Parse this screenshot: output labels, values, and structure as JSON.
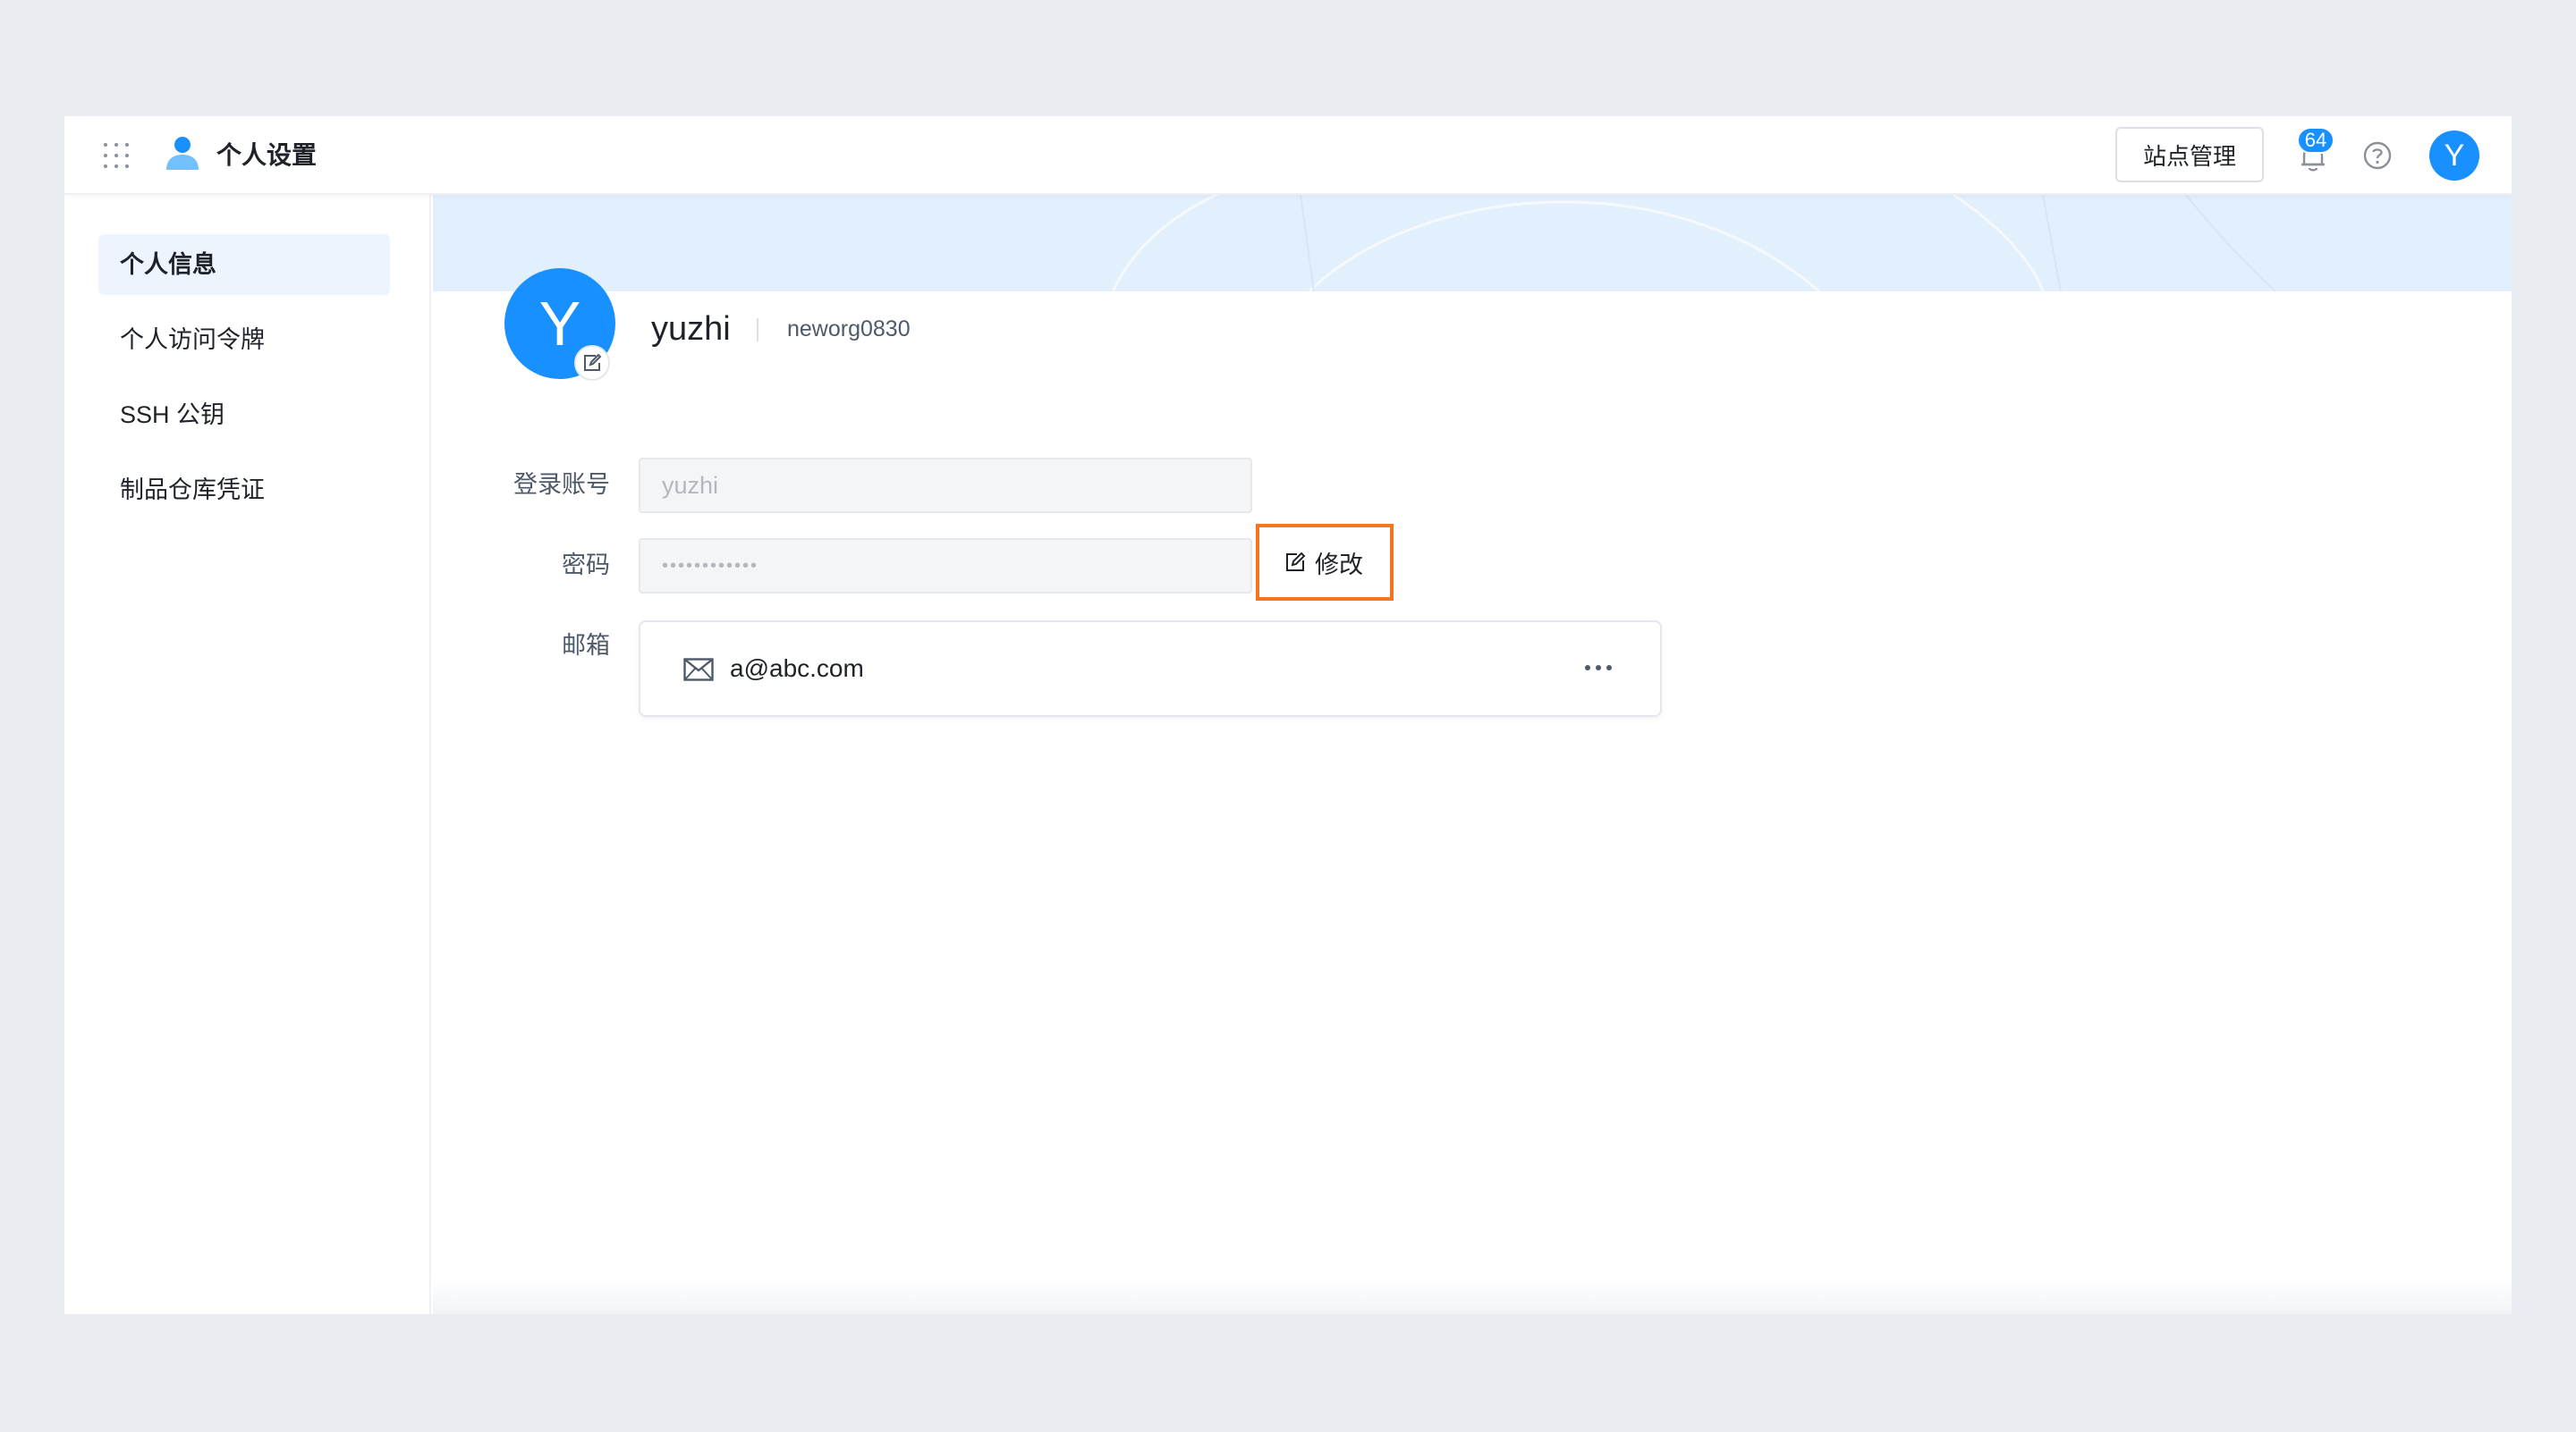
{
  "header": {
    "app_title": "个人设置",
    "site_manage_label": "站点管理",
    "notification_count": "64",
    "user_initial": "Y",
    "icons": [
      "apps-grid-icon",
      "user-icon",
      "bell-icon",
      "help-icon"
    ]
  },
  "sidebar": {
    "items": [
      {
        "label": "个人信息",
        "active": true
      },
      {
        "label": "个人访问令牌",
        "active": false
      },
      {
        "label": "SSH 公钥",
        "active": false
      },
      {
        "label": "制品仓库凭证",
        "active": false
      }
    ]
  },
  "profile": {
    "avatar_initial": "Y",
    "username": "yuzhi",
    "org": "neworg0830"
  },
  "form": {
    "login_label": "登录账号",
    "login_value": "yuzhi",
    "password_label": "密码",
    "password_value": "••••••••••••",
    "edit_label": "修改",
    "email_label": "邮箱",
    "email_value": "a@abc.com"
  },
  "colors": {
    "accent": "#1890ff",
    "highlight": "#f5741f",
    "banner": "#e2effc",
    "active_nav": "#eef4fd"
  }
}
